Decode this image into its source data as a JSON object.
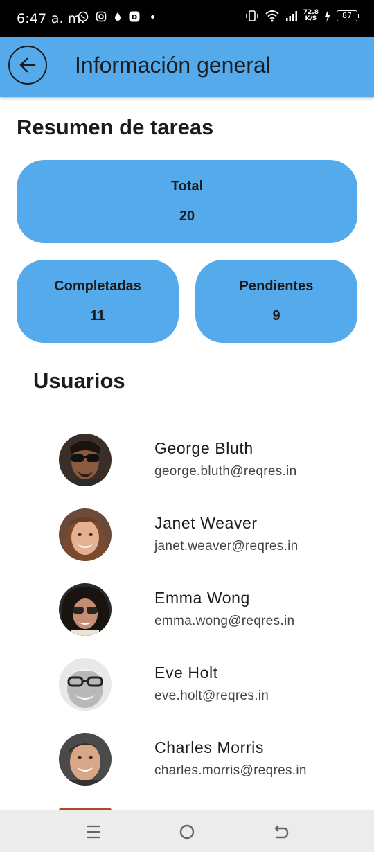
{
  "status_bar": {
    "time": "6:47 a. m.",
    "speed_value": "72.8",
    "speed_unit": "K/S",
    "battery": "87"
  },
  "app_bar": {
    "title": "Información general",
    "back_icon": "arrow-left-icon"
  },
  "summary": {
    "title": "Resumen de tareas",
    "total_label": "Total",
    "total_value": "20",
    "completed_label": "Completadas",
    "completed_value": "11",
    "pending_label": "Pendientes",
    "pending_value": "9"
  },
  "users": {
    "title": "Usuarios",
    "items": [
      {
        "name": "George Bluth",
        "email": "george.bluth@reqres.in"
      },
      {
        "name": "Janet Weaver",
        "email": "janet.weaver@reqres.in"
      },
      {
        "name": "Emma Wong",
        "email": "emma.wong@reqres.in"
      },
      {
        "name": "Eve Holt",
        "email": "eve.holt@reqres.in"
      },
      {
        "name": "Charles Morris",
        "email": "charles.morris@reqres.in"
      }
    ]
  },
  "colors": {
    "accent": "#55aaeb",
    "status_bar": "#000000",
    "nav_bar": "#ececec"
  },
  "nav_bar": {
    "icons": [
      "recent-apps-icon",
      "home-icon",
      "back-icon"
    ]
  }
}
